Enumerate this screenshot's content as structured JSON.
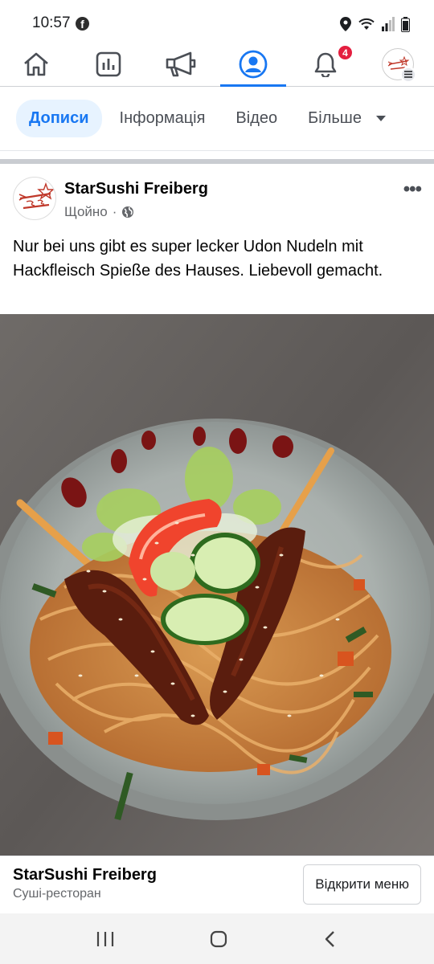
{
  "status_bar": {
    "time": "10:57",
    "fb_glyph": "f"
  },
  "top_nav": {
    "items": [
      {
        "name": "home-icon"
      },
      {
        "name": "pages-icon"
      },
      {
        "name": "megaphone-icon"
      },
      {
        "name": "profile-icon",
        "active": true
      },
      {
        "name": "bell-icon",
        "badge": "4"
      },
      {
        "name": "menu-avatar-icon"
      }
    ]
  },
  "tabs": [
    {
      "label": "Дописи"
    },
    {
      "label": "Інформація"
    },
    {
      "label": "Відео"
    },
    {
      "label": "Більше"
    }
  ],
  "post": {
    "page_name": "StarSushi Freiberg",
    "time": "Щойно",
    "separator": "·",
    "text": "Nur bei uns gibt es super lecker Udon Nudeln mit Hackfleisch Spieße des Hauses. Liebevoll gemacht."
  },
  "bottom_card": {
    "page_name": "StarSushi Freiberg",
    "category": "Суші-ресторан",
    "button_label": "Відкрити меню"
  },
  "colors": {
    "accent": "#1877f2",
    "badge": "#e41e3f",
    "text_secondary": "#65676b"
  }
}
